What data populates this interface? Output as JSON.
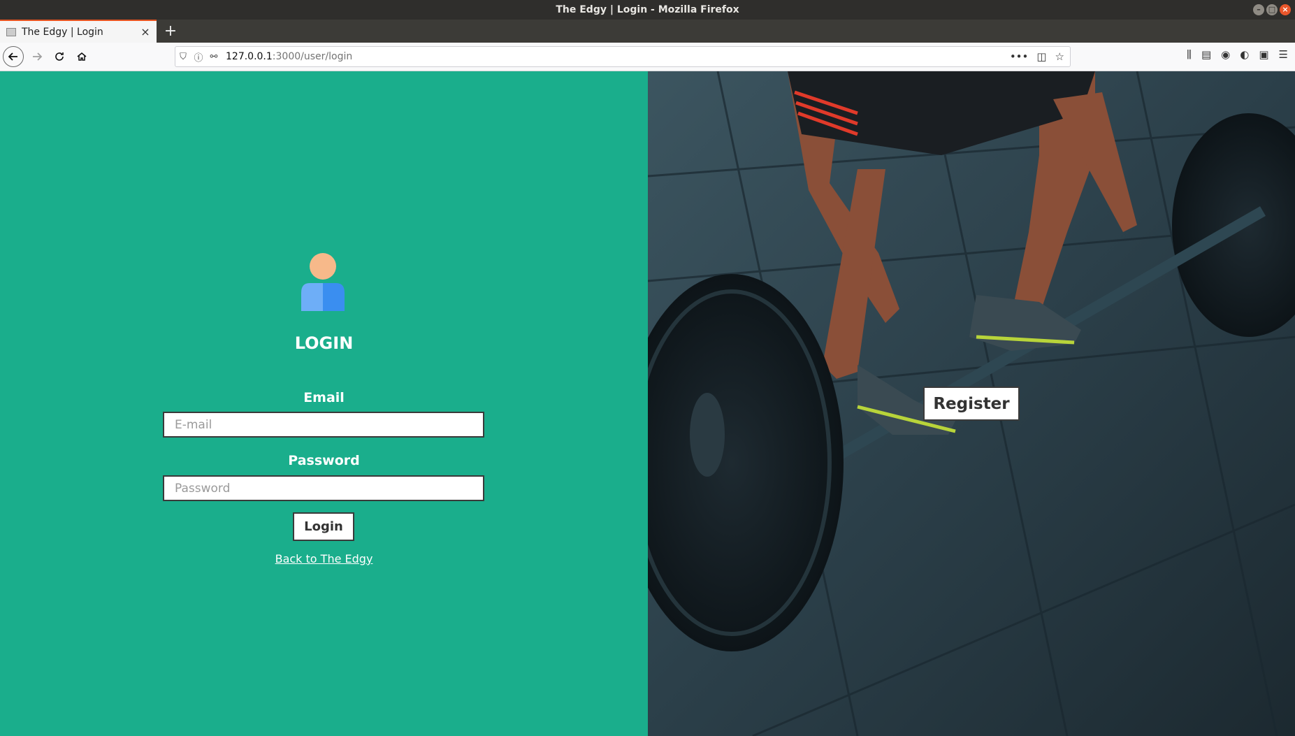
{
  "window": {
    "title": "The Edgy | Login - Mozilla Firefox"
  },
  "tabs": [
    {
      "label": "The Edgy | Login",
      "active": true
    }
  ],
  "navbar": {
    "url_host": "127.0.0.1",
    "url_path": ":3000/user/login"
  },
  "login": {
    "title": "LOGIN",
    "email_label": "Email",
    "email_placeholder": "E-mail",
    "email_value": "",
    "password_label": "Password",
    "password_placeholder": "Password",
    "password_value": "",
    "submit_label": "Login",
    "back_link": "Back to The Edgy"
  },
  "register": {
    "label": "Register"
  },
  "colors": {
    "left_panel_bg": "#1aae8c",
    "avatar_head": "#f7b98a",
    "avatar_body_left": "#6eaef7",
    "avatar_body_right": "#3a8ef0",
    "text_light": "#ffffff",
    "accent_tab": "#e95420"
  },
  "icons": {
    "avatar": "user-avatar-icon",
    "back": "arrow-left-icon",
    "forward": "arrow-right-icon",
    "reload": "reload-icon",
    "home": "home-icon"
  }
}
